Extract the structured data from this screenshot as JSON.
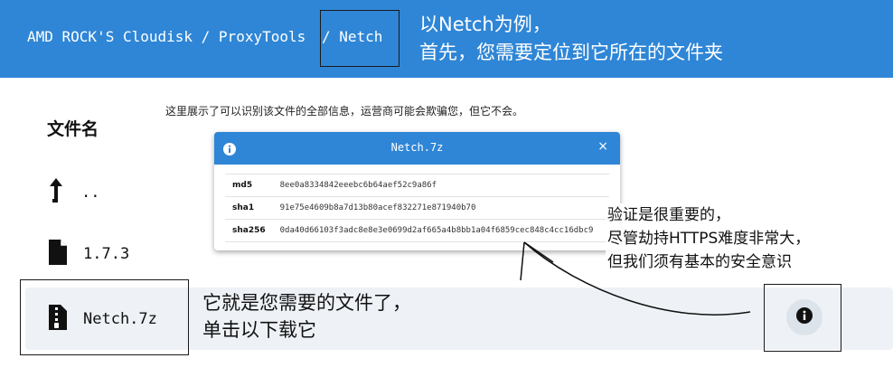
{
  "header": {
    "breadcrumb_root": "AMD ROCK'S Cloudisk / ProxyTools",
    "breadcrumb_current": "/ Netch",
    "annotation_line1": "以Netch为例，",
    "annotation_line2": "首先，您需要定位到它所在的文件夹"
  },
  "notice": "这里展示了可以识别该文件的全部信息，运营商可能会欺骗您，但它不会。",
  "file_list": {
    "column_header": "文件名",
    "items": [
      {
        "label": "..",
        "icon": "level-up-icon"
      },
      {
        "label": "1.7.3",
        "icon": "file-icon"
      },
      {
        "label": "Netch.7z",
        "icon": "file-archive-icon"
      }
    ]
  },
  "modal": {
    "title": "Netch.7z",
    "close": "×",
    "rows": [
      {
        "key": "md5",
        "value": "8ee0a8334842eeebc6b64aef52c9a86f"
      },
      {
        "key": "sha1",
        "value": "91e75e4609b8a7d13b80acef832271e871940b70"
      },
      {
        "key": "sha256",
        "value": "0da40d66103f3adc8e8e3e0699d2af665a4b8bb1a04f6859cec848c4cc16dbc9"
      }
    ]
  },
  "annotations": {
    "verify_line1": "验证是很重要的，",
    "verify_line2": "尽管劫持HTTPS难度非常大，",
    "verify_line3": "但我们须有基本的安全意识",
    "file_line1": "它就是您需要的文件了，",
    "file_line2": "单击以下载它"
  },
  "colors": {
    "primary": "#2f86d6",
    "row_highlight": "#eef2f6"
  }
}
